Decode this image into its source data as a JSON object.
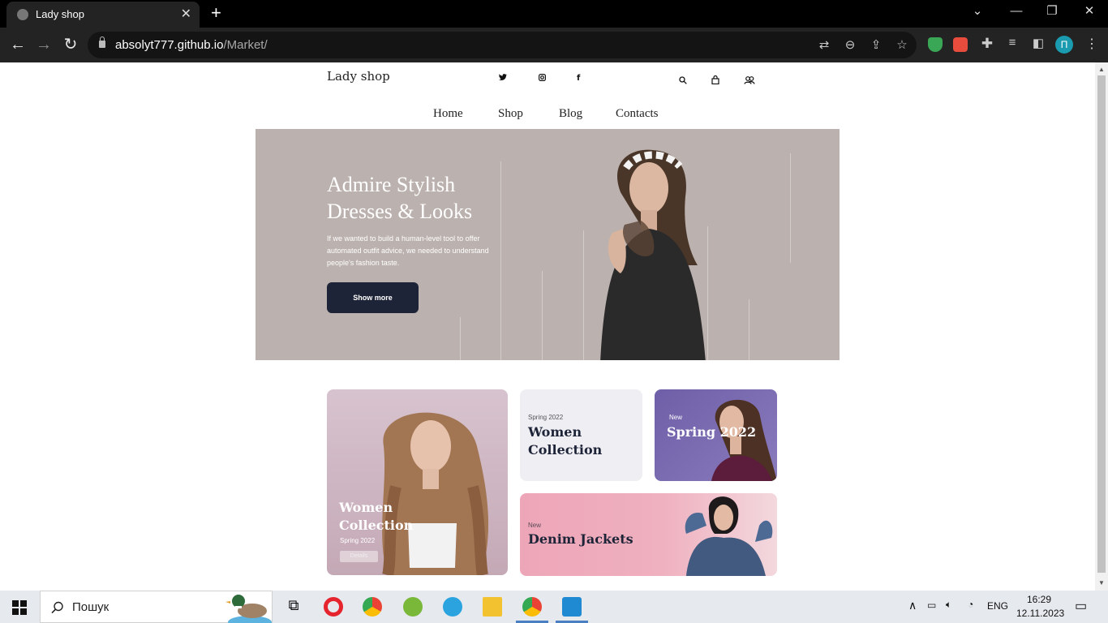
{
  "browser": {
    "tab_title": "Lady shop",
    "new_tab": "+",
    "url_domain": "absolyt777.github.io",
    "url_path": "/Market/",
    "profile_initial": "П",
    "window_controls": [
      "⌄",
      "—",
      "❐",
      "✕"
    ]
  },
  "site": {
    "logo": "Lady shop",
    "social": [
      "twitter",
      "instagram",
      "facebook"
    ],
    "nav": [
      "Home",
      "Shop",
      "Blog",
      "Contacts"
    ],
    "hero": {
      "title": "Admire Stylish Dresses & Looks",
      "text": "If we wanted to build a human-level tool to offer automated outfit advice, we needed to understand people's fashion taste.",
      "button": "Show more"
    },
    "cards": {
      "big": {
        "title": "Women Collection",
        "subtitle": "Spring 2022",
        "button": "Details"
      },
      "women": {
        "eyebrow": "Spring 2022",
        "title": "Women Collection"
      },
      "spring": {
        "eyebrow": "New",
        "title": "Spring 2022"
      },
      "denim": {
        "eyebrow": "New",
        "title": "Denim Jackets"
      }
    }
  },
  "taskbar": {
    "search_placeholder": "Пошук",
    "language": "ENG",
    "time": "16:29",
    "date": "12.11.2023"
  },
  "colors": {
    "hero_bg": "#bbb1ae",
    "hero_button": "#1e2438",
    "spring_card": "#6e5fa8",
    "denim_card": "#eda6b8"
  }
}
